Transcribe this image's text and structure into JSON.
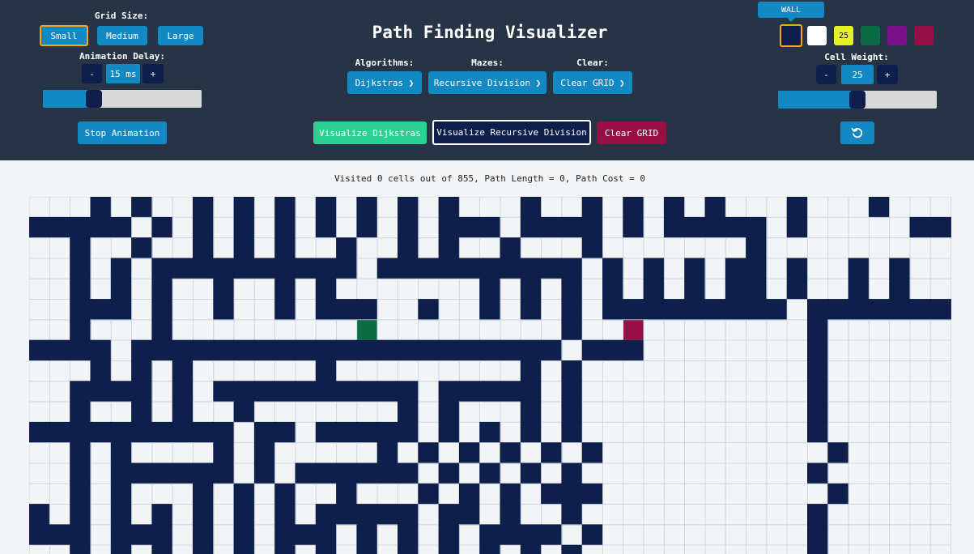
{
  "header": {
    "title": "Path Finding Visualizer",
    "grid_size_label": "Grid Size:",
    "grid_sizes": [
      "Small",
      "Medium",
      "Large"
    ],
    "animation_delay_label": "Animation Delay:",
    "delay_minus": "-",
    "delay_value": "15 ms",
    "delay_plus": "+",
    "delay_slider_level": 0.32,
    "stop_animation": "Stop Animation",
    "algorithms_label": "Algorithms:",
    "algorithm_selected": "Dijkstras ❯",
    "mazes_label": "Mazes:",
    "maze_selected": "Recursive Division ❯",
    "clear_label": "Clear:",
    "clear_selected": "Clear GRID ❯",
    "visualize_algorithm": "Visualize Dijkstras",
    "visualize_maze": "Visualize Recursive Division",
    "clear_grid": "Clear GRID",
    "tool_tooltip": "WALL",
    "swatch_weight_text": "25",
    "cell_weight_label": "Cell Weight:",
    "weight_minus": "-",
    "weight_value": "25",
    "weight_plus": "+",
    "weight_slider_level": 0.5,
    "reset_icon": "rotate-ccw-icon"
  },
  "stats": {
    "text": "Visited 0 cells out of 855, Path Length = 0, Path Cost = 0"
  },
  "colors": {
    "header_bg": "#263445",
    "accent": "#1389c4",
    "wall": "#0d1f4a",
    "start": "#0a6b45",
    "end": "#950f44",
    "grid_bg": "#f2f4f6",
    "grid_line": "#c9d8e8",
    "swatch_weight": "#e6f224",
    "swatch_green": "#0a6b45",
    "swatch_purple": "#7b0f8c",
    "swatch_crimson": "#950f44",
    "visualize_green": "#2bd192",
    "selected_outline": "#f3a712"
  },
  "grid": {
    "cols": 45,
    "rows": 18,
    "rows_data": [
      "...#.#..#.#.#.#.#.#.#...#..#.#.#.#...#...#...",
      "#####.#.#.#.#.#.#.#.###.####.#.#####.#.....##",
      "..#..#..#.#.#..#..#.#..#...#.......#.........",
      "..#.#.##########.##########.#.#.#.##.#..#.#..",
      "..#.#.#..#..#.#.......#.#.#.#.#.#.##.#..#.#..",
      "..###.#..#..#.###..#..#.#.#.#########.#######",
      "..#...#.........S.........#..E........#......",
      "####.#####################.###........#......",
      "...#.#.#......#.........#.#...........#......",
      "..####.#.##########.#####.#...........#......",
      "..#..#.#..#.......#.#...#.#...........#......",
      "##########.##.#####.#.#.#.#...........#......",
      "..#.#....#.#.....#.#.#.#.#.#...........#......",
      "..#.######.#.######.#.#.#.#...........#......",
      "..#.#...#.#.#..#...#.#.#.###...........#......",
      "#.#.#.#.#.#.#.#####.##.#..#...........#......",
      "###.###.#.#.###.#.#.#.####.#..........#......",
      "..#.#.#.#.#.#.#.#.#.#.#.#.#...........#......"
    ]
  }
}
